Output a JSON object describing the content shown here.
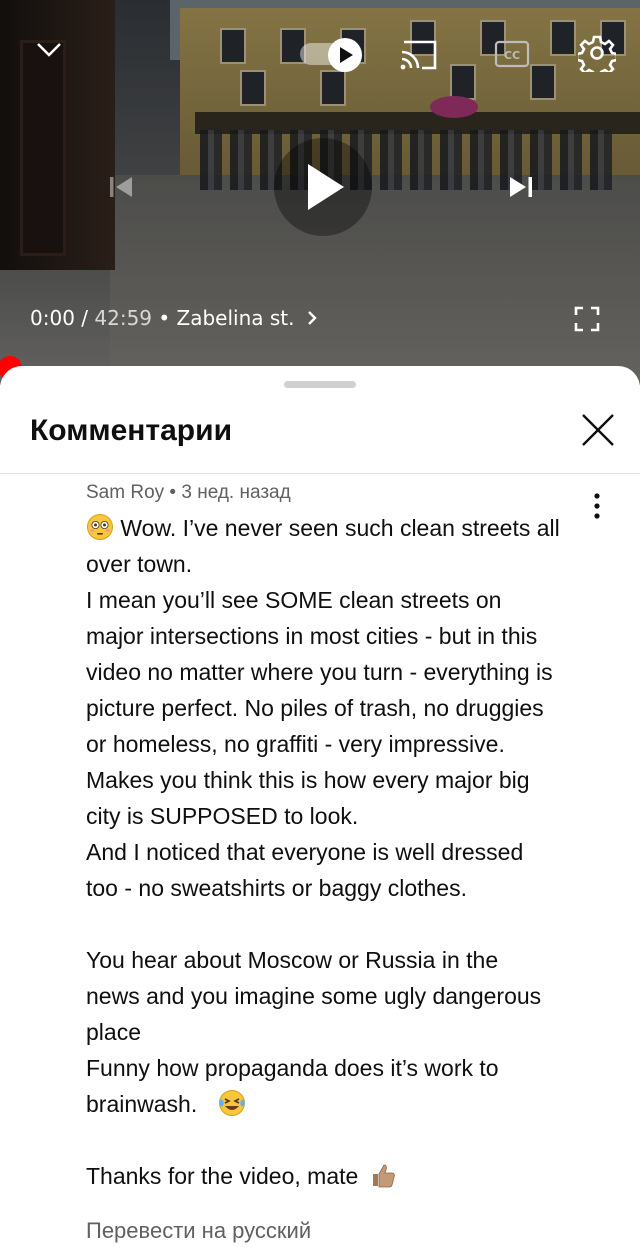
{
  "player": {
    "current_time": "0:00",
    "separator": " / ",
    "duration": "42:59",
    "chapter_separator": " • ",
    "chapter": "Zabelina st.",
    "chapter_chevron": "›",
    "autoplay_on": true,
    "icons": [
      "chevron-down-icon",
      "play-icon",
      "cast-icon",
      "closed-captions-icon",
      "gear-icon",
      "skip-previous-icon",
      "play-icon",
      "skip-next-icon",
      "fullscreen-icon"
    ],
    "progress": 0.0,
    "accent_color": "#ff0000"
  },
  "comments_panel": {
    "title": "Комментарии",
    "close_icon": "close-icon"
  },
  "comment": {
    "author": "Sam Roy",
    "meta_sep": " • ",
    "time_ago": "3 нед. назад",
    "lines": [
      "Wow. I’ve never seen such clean streets all",
      "over town.",
      "I mean you’ll see SOME clean streets on",
      "major intersections in most cities - but in this",
      "video no matter where you turn - everything is",
      "picture perfect. No piles of trash, no druggies",
      "or homeless, no graffiti - very impressive.",
      "Makes you think this is how every major big",
      "city is SUPPOSED to look.",
      "And  I noticed that everyone is well dressed",
      "too - no sweatshirts or baggy clothes.",
      "",
      "You hear about Moscow or Russia in the",
      "news and you imagine some ugly dangerous",
      "place",
      "Funny how propaganda does it’s work to",
      "brainwash.",
      "",
      "Thanks for the video, mate"
    ],
    "emoji": [
      "flushed-face-emoji",
      "laughing-tears-emoji",
      "thumbs-up-emoji"
    ],
    "translate_label": "Перевести на русский"
  }
}
